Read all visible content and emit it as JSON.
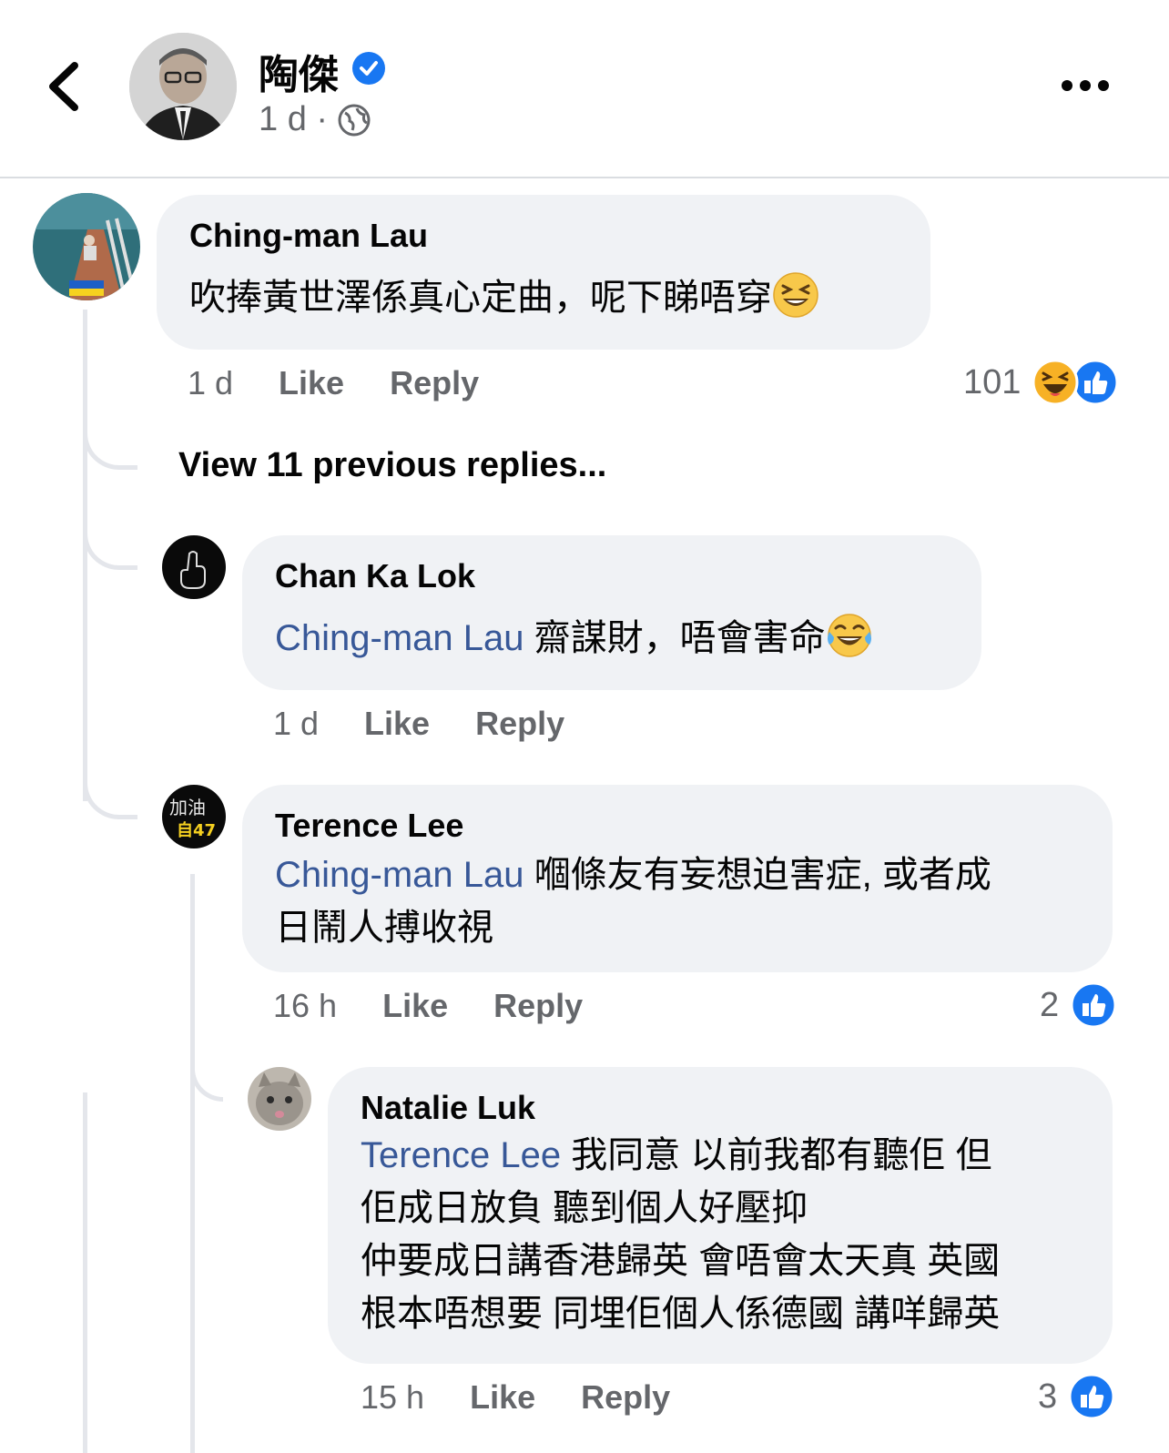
{
  "header": {
    "author_name": "陶傑",
    "timestamp": "1 d ·",
    "back_icon": "chevron-left-icon",
    "more_icon": "more-horizontal-icon",
    "verified_icon": "verified-badge-icon",
    "audience_icon": "globe-icon"
  },
  "comments": [
    {
      "author": "Ching-man Lau",
      "text": "吹捧黃世澤係真心定曲，呢下睇唔穿",
      "emoji": "grinning-squinting-emoji",
      "time": "1 d",
      "like_label": "Like",
      "reply_label": "Reply",
      "reaction_count": "101"
    }
  ],
  "view_previous": "View 11 previous replies...",
  "replies": [
    {
      "author": "Chan Ka Lok",
      "mention": "Ching-man Lau",
      "text": " 齋謀財，唔會害命",
      "emoji": "tears-of-joy-emoji",
      "time": "1 d",
      "like_label": "Like",
      "reply_label": "Reply"
    },
    {
      "author": "Terence Lee",
      "mention": "Ching-man Lau",
      "text_line1": " 嗰條友有妄想迫害症, 或者成",
      "text_line2": "日鬧人搏收視",
      "time": "16 h",
      "like_label": "Like",
      "reply_label": "Reply",
      "reaction_count": "2"
    },
    {
      "author": "Natalie Luk",
      "mention": "Terence Lee",
      "text_line1": " 我同意 以前我都有聽佢 但",
      "text_line2": "佢成日放負 聽到個人好壓抑",
      "text_line3": "仲要成日講香港歸英 會唔會太天真 英國",
      "text_line4": "根本唔想要 同埋佢個人係德國 講咩歸英",
      "time": "15 h",
      "like_label": "Like",
      "reply_label": "Reply",
      "reaction_count": "3"
    }
  ],
  "colors": {
    "link": "#385898",
    "bubble": "#f0f2f5",
    "meta": "#65676b",
    "like_blue": "#1877f2"
  }
}
